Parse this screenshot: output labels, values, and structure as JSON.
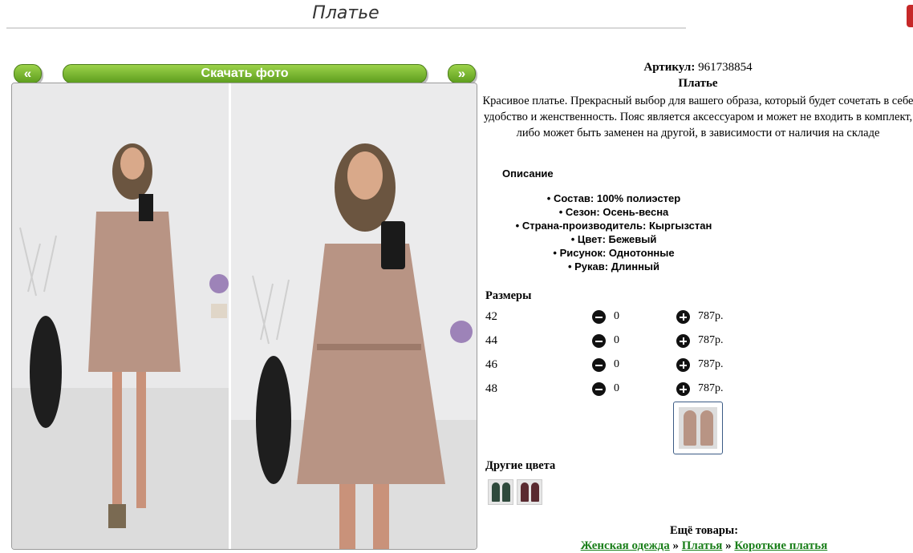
{
  "page": {
    "title": "Платье"
  },
  "gallery": {
    "prev_label": "«",
    "next_label": "»",
    "download_label": "Скачать фото",
    "photos": [
      "dress-photo-mirror-selfie-left",
      "dress-photo-mirror-selfie-right"
    ]
  },
  "product": {
    "article_label": "Артикул:",
    "article_value": "961738854",
    "name": "Платье",
    "description": "Красивое платье. Прекрасный выбор для вашего образа, который будет сочетать в себе удобство и женственность. Пояс является аксессуаром и может не входить в комплект, либо может быть заменен на другой, в зависимости от наличия на складе",
    "details_heading": "Описание",
    "properties": [
      "Состав: 100% полиэстер",
      "Сезон: Осень-весна",
      "Страна-производитель: Кыргызстан",
      "Цвет: Бежевый",
      "Рисунок: Однотонные",
      "Рукав: Длинный"
    ]
  },
  "sizes": {
    "heading": "Размеры",
    "rows": [
      {
        "size": "42",
        "qty": "0",
        "price": "787р."
      },
      {
        "size": "44",
        "qty": "0",
        "price": "787р."
      },
      {
        "size": "46",
        "qty": "0",
        "price": "787р."
      },
      {
        "size": "48",
        "qty": "0",
        "price": "787р."
      }
    ]
  },
  "other_colors": {
    "heading": "Другие цвета",
    "swatches": [
      "#2f4a3c",
      "#5a2a30"
    ]
  },
  "more": {
    "heading": "Ещё товары:",
    "breadcrumb": [
      "Женская одежда",
      "Платья",
      "Короткие платья"
    ],
    "separator": "»"
  },
  "colors": {
    "button_green": "#6aa82a",
    "link_green": "#1a7f1a",
    "dress_beige": "#b89484"
  }
}
